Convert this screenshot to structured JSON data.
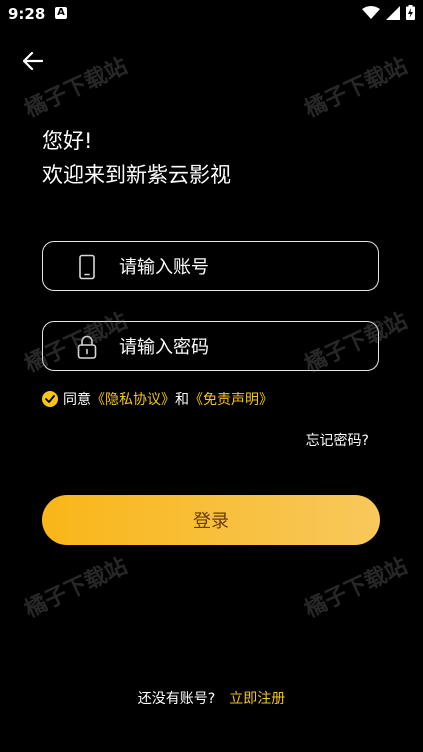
{
  "status_bar": {
    "time": "9:28",
    "notification_glyph": "A",
    "icons": [
      "wifi-icon",
      "signal-icon",
      "battery-charging-icon"
    ]
  },
  "greeting": {
    "line1": "您好!",
    "line2": "欢迎来到新紫云影视"
  },
  "account_field": {
    "placeholder": "请输入账号",
    "icon": "phone-icon"
  },
  "password_field": {
    "placeholder": "请输入密码",
    "icon": "lock-icon"
  },
  "agreement": {
    "prefix": "同意",
    "privacy_link": "《隐私协议》",
    "and": "和",
    "disclaimer_link": "《免责声明》",
    "checked": true
  },
  "forgot_password": "忘记密码?",
  "login_button": "登录",
  "register": {
    "question": "还没有账号?",
    "link": "立即注册"
  },
  "watermark": "橘子下载站",
  "colors": {
    "background": "#000000",
    "accent": "#f5c518",
    "button_gradient_start": "#f9b618",
    "button_gradient_end": "#f8c85c",
    "button_text": "#6b3a07"
  }
}
